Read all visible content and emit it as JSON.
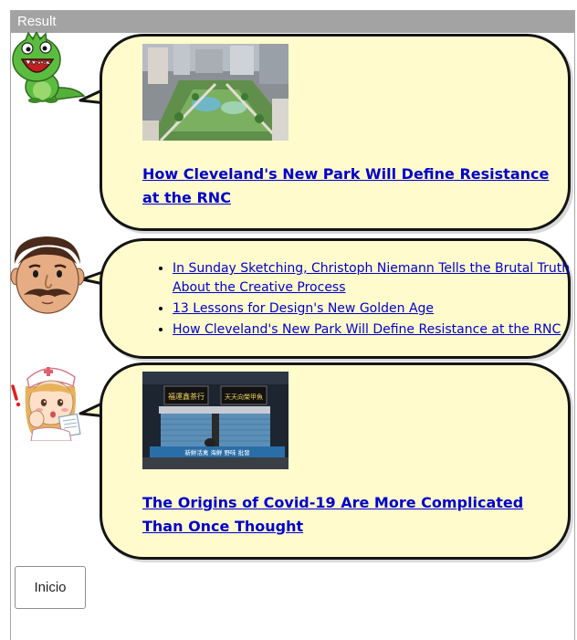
{
  "window": {
    "title": "Result"
  },
  "messages": [
    {
      "avatar": "green-dinosaur-avatar",
      "image": "aerial-park-photo",
      "link_text": "How Cleveland's New Park Will Define Resistance at the RNC"
    },
    {
      "avatar": "mustache-man-avatar",
      "links": [
        "In Sunday Sketching, Christoph Niemann Tells the Brutal Truth About the Creative Process",
        "13 Lessons for Design's New Golden Age",
        "How Cleveland's New Park Will Define Resistance at the RNC"
      ]
    },
    {
      "avatar": "nurse-avatar",
      "image": "closed-shop-photo",
      "link_text": "The Origins of Covid-19 Are More Complicated Than Once Thought"
    }
  ],
  "shop_signs": [
    "福運鑫茶行",
    "天天向榮甲魚"
  ],
  "shop_banner": "新鮮活禽 海鮮 野味 批發",
  "footer": {
    "inicio_label": "Inicio"
  },
  "colors": {
    "bubble_fill": "#fffbcc",
    "bubble_border": "#141414",
    "link": "#0000cc",
    "titlebar": "#a3a3a3"
  }
}
